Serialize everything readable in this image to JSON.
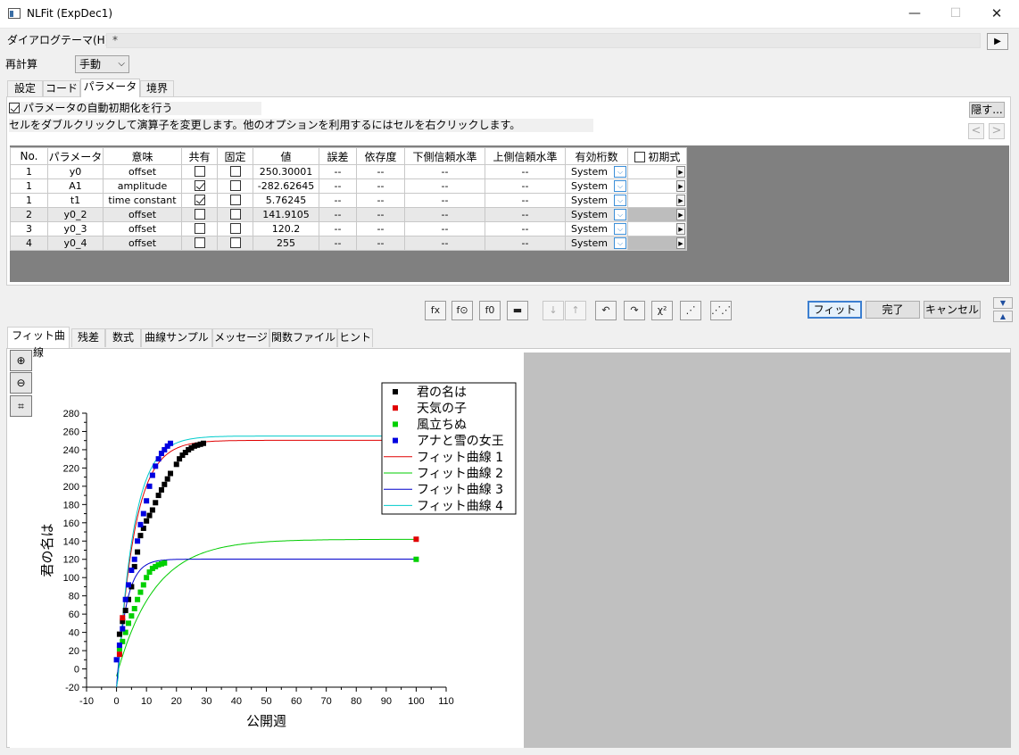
{
  "window": {
    "title": "NLFit (ExpDec1)",
    "min_glyph": "—",
    "max_glyph": "☐",
    "close_glyph": "✕"
  },
  "theme": {
    "label": "ダイアログテーマ(H)",
    "value": "*",
    "arrow": "▶"
  },
  "recalc": {
    "label": "再計算",
    "value": "手動",
    "chevron": "⌵"
  },
  "tabs": [
    {
      "label": "設定"
    },
    {
      "label": "コード"
    },
    {
      "label": "パラメータ"
    },
    {
      "label": "境界"
    }
  ],
  "params_panel": {
    "auto_init_label": "パラメータの自動初期化を行う",
    "auto_init_checked": true,
    "hint": "セルをダブルクリックして演算子を変更します。他のオプションを利用するにはセルを右クリックします。",
    "hide_button": "隠す...",
    "prev": "<",
    "next": ">"
  },
  "table": {
    "headers": [
      "No.",
      "パラメータ",
      "意味",
      "共有",
      "固定",
      "値",
      "誤差",
      "依存度",
      "下側信頼水準",
      "上側信頼水準",
      "有効桁数",
      "初期式"
    ],
    "rows": [
      {
        "no": "1",
        "param": "y0",
        "meaning": "offset",
        "shared": false,
        "fixed": false,
        "value": "250.30001",
        "error": "--",
        "dep": "--",
        "lcl": "--",
        "ucl": "--",
        "sig": "System",
        "shade": false
      },
      {
        "no": "1",
        "param": "A1",
        "meaning": "amplitude",
        "shared": true,
        "fixed": false,
        "value": "-282.62645",
        "error": "--",
        "dep": "--",
        "lcl": "--",
        "ucl": "--",
        "sig": "System",
        "shade": false
      },
      {
        "no": "1",
        "param": "t1",
        "meaning": "time constant",
        "shared": true,
        "fixed": false,
        "value": "5.76245",
        "error": "--",
        "dep": "--",
        "lcl": "--",
        "ucl": "--",
        "sig": "System",
        "shade": false
      },
      {
        "no": "2",
        "param": "y0_2",
        "meaning": "offset",
        "shared": false,
        "fixed": false,
        "value": "141.9105",
        "error": "--",
        "dep": "--",
        "lcl": "--",
        "ucl": "--",
        "sig": "System",
        "shade": true
      },
      {
        "no": "3",
        "param": "y0_3",
        "meaning": "offset",
        "shared": false,
        "fixed": false,
        "value": "120.2",
        "error": "--",
        "dep": "--",
        "lcl": "--",
        "ucl": "--",
        "sig": "System",
        "shade": false
      },
      {
        "no": "4",
        "param": "y0_4",
        "meaning": "offset",
        "shared": false,
        "fixed": false,
        "value": "255",
        "error": "--",
        "dep": "--",
        "lcl": "--",
        "ucl": "--",
        "sig": "System",
        "shade": true
      }
    ]
  },
  "toolbar": {
    "icons": [
      "fit-until-converged-icon",
      "one-iteration-icon",
      "initialize-icon",
      "save-icon",
      "sort-down-icon",
      "sort-up-icon",
      "undo-icon",
      "redo-icon",
      "chi-square-icon",
      "fit-step-icon",
      "fit-all-icon"
    ],
    "chi_label": "χ²",
    "fit": "フィット",
    "done": "完了",
    "cancel": "キャンセル",
    "up": "▼",
    "down": "▲"
  },
  "bottom_tabs": [
    {
      "label": "フィット曲線"
    },
    {
      "label": "残差"
    },
    {
      "label": "数式"
    },
    {
      "label": "曲線サンプル"
    },
    {
      "label": "メッセージ"
    },
    {
      "label": "関数ファイル"
    },
    {
      "label": "ヒント"
    }
  ],
  "colors": {
    "series1": "#000000",
    "series2": "#e00000",
    "series3": "#00d000",
    "series4": "#0000e0",
    "fit1": "#e00000",
    "fit2": "#00cc00",
    "fit3": "#0000cc",
    "fit4": "#00cccc"
  },
  "chart_data": {
    "type": "scatter",
    "xlabel": "公開週",
    "ylabel": "君の名は",
    "xlim": [
      -10,
      110
    ],
    "ylim": [
      -20,
      280
    ],
    "xticks": [
      -10,
      0,
      10,
      20,
      30,
      40,
      50,
      60,
      70,
      80,
      90,
      100,
      110
    ],
    "yticks": [
      -20,
      0,
      20,
      40,
      60,
      80,
      100,
      120,
      140,
      160,
      180,
      200,
      220,
      240,
      260,
      280
    ],
    "legend_position": "top-right",
    "series": [
      {
        "name": "君の名は",
        "color_key": "series1",
        "points": [
          [
            1,
            38
          ],
          [
            2,
            52
          ],
          [
            3,
            64
          ],
          [
            4,
            76
          ],
          [
            5,
            90
          ],
          [
            6,
            112
          ],
          [
            7,
            128
          ],
          [
            8,
            146
          ],
          [
            9,
            154
          ],
          [
            10,
            162
          ],
          [
            11,
            168
          ],
          [
            12,
            174
          ],
          [
            13,
            182
          ],
          [
            14,
            190
          ],
          [
            15,
            196
          ],
          [
            16,
            202
          ],
          [
            17,
            208
          ],
          [
            18,
            214
          ],
          [
            20,
            224
          ],
          [
            21,
            230
          ],
          [
            22,
            234
          ],
          [
            23,
            237
          ],
          [
            24,
            240
          ],
          [
            25,
            242
          ],
          [
            26,
            244
          ],
          [
            27,
            245
          ],
          [
            28,
            246
          ],
          [
            29,
            247
          ]
        ]
      },
      {
        "name": "天気の子",
        "color_key": "series2",
        "points": [
          [
            1,
            16
          ],
          [
            2,
            56
          ],
          [
            100,
            142
          ]
        ]
      },
      {
        "name": "風立ちぬ",
        "color_key": "series3",
        "points": [
          [
            1,
            22
          ],
          [
            2,
            30
          ],
          [
            3,
            40
          ],
          [
            4,
            50
          ],
          [
            5,
            58
          ],
          [
            6,
            66
          ],
          [
            7,
            76
          ],
          [
            8,
            84
          ],
          [
            9,
            92
          ],
          [
            10,
            100
          ],
          [
            11,
            106
          ],
          [
            12,
            110
          ],
          [
            13,
            112
          ],
          [
            14,
            114
          ],
          [
            15,
            115
          ],
          [
            16,
            116
          ],
          [
            100,
            120
          ]
        ]
      },
      {
        "name": "アナと雪の女王",
        "color_key": "series4",
        "points": [
          [
            0,
            10
          ],
          [
            1,
            26
          ],
          [
            2,
            44
          ],
          [
            3,
            76
          ],
          [
            4,
            92
          ],
          [
            5,
            108
          ],
          [
            6,
            120
          ],
          [
            7,
            140
          ],
          [
            8,
            158
          ],
          [
            9,
            170
          ],
          [
            10,
            184
          ],
          [
            11,
            200
          ],
          [
            12,
            212
          ],
          [
            13,
            222
          ],
          [
            14,
            230
          ],
          [
            15,
            236
          ],
          [
            16,
            240
          ],
          [
            17,
            244
          ],
          [
            18,
            247
          ]
        ]
      }
    ],
    "fits": [
      {
        "name": "フィット曲線 1",
        "color_key": "fit1",
        "y0": 250.3,
        "A1": -282.62645,
        "t1": 5.76245
      },
      {
        "name": "フィット曲線 2",
        "color_key": "fit2",
        "y0": 141.9105,
        "A1": -150,
        "t1": 12.5
      },
      {
        "name": "フィット曲線 3",
        "color_key": "fit3",
        "y0": 120.2,
        "A1": -140,
        "t1": 3.2
      },
      {
        "name": "フィット曲線 4",
        "color_key": "fit4",
        "y0": 255,
        "A1": -290,
        "t1": 5.5
      }
    ]
  }
}
